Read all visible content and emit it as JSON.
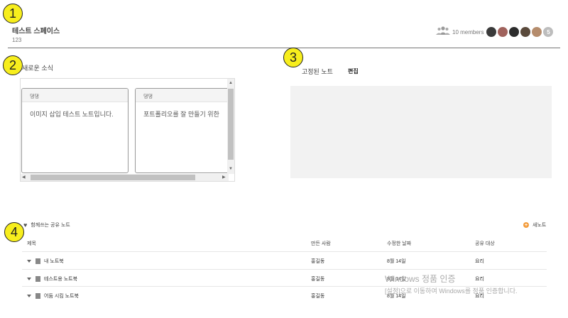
{
  "markers": [
    "1",
    "2",
    "3",
    "4"
  ],
  "space": {
    "title": "테스트 스페이스",
    "subtitle": "123"
  },
  "members": {
    "label": "10 members",
    "icon": "group-icon",
    "avatars": [
      {
        "name": "avatar-1",
        "color": "#3a3a3a"
      },
      {
        "name": "avatar-2",
        "color": "#a0625c"
      },
      {
        "name": "avatar-3",
        "color": "#2c2c2c"
      },
      {
        "name": "avatar-4",
        "color": "#5a4a3c"
      },
      {
        "name": "avatar-5",
        "color": "#b58c6c"
      }
    ],
    "more_count": "5"
  },
  "news": {
    "title": "새로운 소식",
    "cards": [
      {
        "author": "댕댕",
        "text": "이미지 삽입 테스트 노트입니다."
      },
      {
        "author": "댕댕",
        "text": "포트폴리오를 잘 만들기 위한"
      }
    ]
  },
  "pinned": {
    "title": "고정된 노트",
    "edit_label": "편집"
  },
  "shared": {
    "title": "함께쓰는 공유 노트",
    "new_note_label": "새노트",
    "columns": [
      "제목",
      "만든 사람",
      "수정한 날짜",
      "공유 대상"
    ],
    "rows": [
      {
        "title": "내 노트북",
        "creator": "홍길동",
        "date": "8월 14일",
        "target": "요리"
      },
      {
        "title": "테스트용 노트북",
        "creator": "홍길동",
        "date": "8월 14일",
        "target": "요리"
      },
      {
        "title": "어둠 시킴 노트북",
        "creator": "홍길동",
        "date": "8월 14일",
        "target": "요리"
      }
    ]
  },
  "watermark": {
    "line1": "Windows 정품 인증",
    "line2": "[설정]으로 이동하여 Windows를 정품 인증합니다."
  },
  "colors": {
    "marker": "#f7ee1d",
    "accent": "#f39c3c",
    "pinned_bg": "#f2f2f2"
  }
}
